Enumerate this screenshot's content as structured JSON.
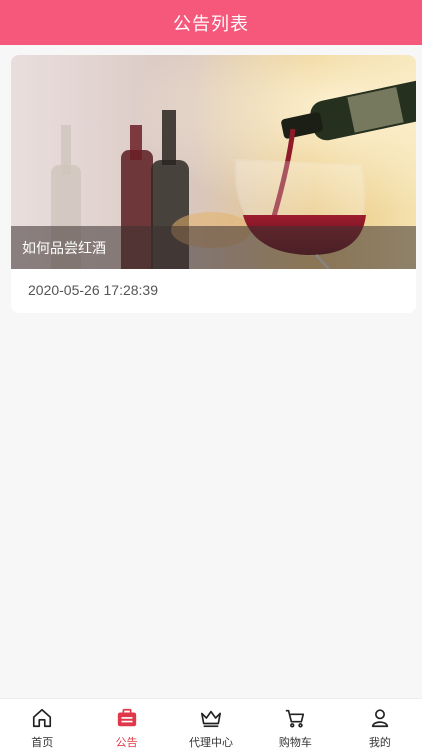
{
  "header": {
    "title": "公告列表"
  },
  "notices": [
    {
      "title": "如何品尝红酒",
      "date": "2020-05-26 17:28:39"
    }
  ],
  "tabbar": {
    "items": [
      {
        "label": "首页",
        "icon": "home-icon"
      },
      {
        "label": "公告",
        "icon": "notice-icon",
        "active": true
      },
      {
        "label": "代理中心",
        "icon": "crown-icon"
      },
      {
        "label": "购物车",
        "icon": "cart-icon"
      },
      {
        "label": "我的",
        "icon": "user-icon"
      }
    ]
  },
  "colors": {
    "header": "#f5587b",
    "active_tab": "#e0384a",
    "background": "#f7f7f7"
  }
}
